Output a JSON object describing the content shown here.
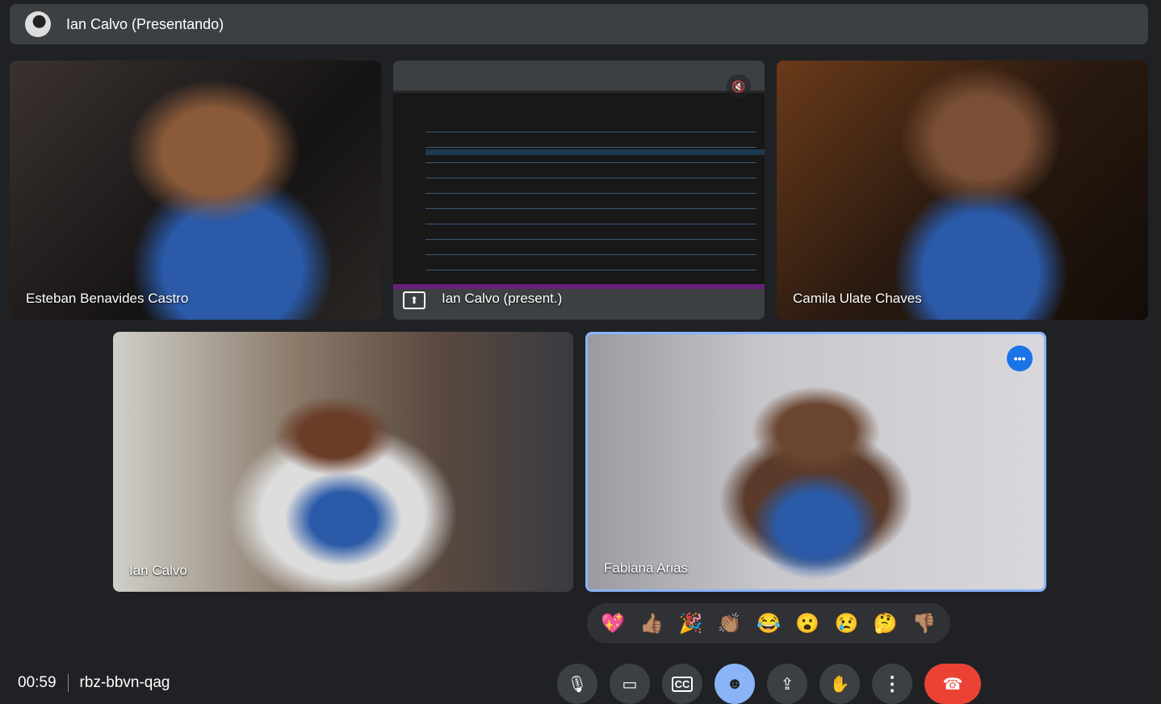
{
  "header": {
    "title": "Ian Calvo (Presentando)"
  },
  "tiles": [
    {
      "name": "Esteban Benavides Castro"
    },
    {
      "name": "Ian Calvo (present.)"
    },
    {
      "name": "Camila Ulate Chaves"
    },
    {
      "name": "Ian Calvo"
    },
    {
      "name": "Fabiana Arias"
    }
  ],
  "reactions": [
    "💖",
    "👍🏽",
    "🎉",
    "👏🏽",
    "😂",
    "😮",
    "😢",
    "🤔",
    "👎🏽"
  ],
  "meeting": {
    "time": "00:59",
    "code": "rbz-bbvn-qag"
  },
  "colors": {
    "accent": "#8ab4f8",
    "hangup": "#ea4335",
    "surface": "#3c4043",
    "background": "#202124"
  }
}
